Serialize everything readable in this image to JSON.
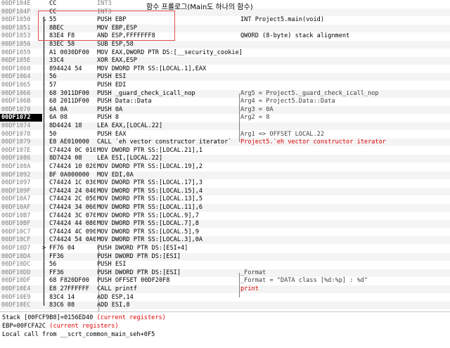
{
  "annotation": "함수 프롤로그(Main도 하나의 함수)",
  "rows": [
    {
      "addr": "00DF104E",
      "mark": "",
      "bytes": "CC",
      "dis": "INT3",
      "cmt": ""
    },
    {
      "addr": "00DF104F",
      "mark": "",
      "bytes": "CC",
      "dis": "INT3",
      "cmt": ""
    },
    {
      "addr": "00DF1050",
      "mark": "$",
      "bytes": "55",
      "dis": "PUSH EBP",
      "cmt": "INT Project5.main(void)"
    },
    {
      "addr": "00DF1051",
      "mark": "·",
      "bytes": "8BEC",
      "dis": "MOV EBP,ESP",
      "cmt": ""
    },
    {
      "addr": "00DF1053",
      "mark": "·",
      "bytes": "83E4 F8",
      "dis": "AND ESP,FFFFFFF8",
      "cmt": "QWORD (8-byte) stack alignment"
    },
    {
      "addr": "00DF1056",
      "mark": "·",
      "bytes": "83EC 58",
      "dis": "SUB ESP,58",
      "cmt": ""
    },
    {
      "addr": "00DF1059",
      "mark": "·",
      "bytes": "A1 0030DF00",
      "dis": "MOV EAX,DWORD PTR DS:[__security_cookie]",
      "cmt": ""
    },
    {
      "addr": "00DF105E",
      "mark": "·",
      "bytes": "33C4",
      "dis": "XOR EAX,ESP",
      "cmt": ""
    },
    {
      "addr": "00DF1060",
      "mark": "·",
      "bytes": "894424 54",
      "dis": "MOV DWORD PTR SS:[LOCAL.1],EAX",
      "cmt": ""
    },
    {
      "addr": "00DF1064",
      "mark": "·",
      "bytes": "56",
      "dis": "PUSH ESI",
      "cmt": ""
    },
    {
      "addr": "00DF1065",
      "mark": "·",
      "bytes": "57",
      "dis": "PUSH EDI",
      "cmt": ""
    },
    {
      "addr": "00DF1066",
      "mark": "·",
      "bytes": "68 3011DF00",
      "dis": "PUSH _guard_check_icall_nop",
      "cmt": "Arg5 = Project5._guard_check_icall_nop"
    },
    {
      "addr": "00DF106B",
      "mark": "·",
      "bytes": "68 2011DF00",
      "dis": "PUSH Data::Data",
      "cmt": "Arg4 = Project5.Data::Data"
    },
    {
      "addr": "00DF1070",
      "mark": "·",
      "bytes": "6A 0A",
      "dis": "PUSH 0A",
      "cmt": "Arg3 = 0A"
    },
    {
      "addr": "00DF1072",
      "mark": "·",
      "bytes": "6A 08",
      "dis": "PUSH 8",
      "cmt": "Arg2 = 8"
    },
    {
      "addr": "00DF1074",
      "mark": "·",
      "bytes": "8D4424 18",
      "dis": "LEA EAX,[LOCAL.22]",
      "cmt": ""
    },
    {
      "addr": "00DF1078",
      "mark": "·",
      "bytes": "50",
      "dis": "PUSH EAX",
      "cmt": "Arg1 => OFFSET LOCAL.22"
    },
    {
      "addr": "00DF1079",
      "mark": "·",
      "bytes": "E8 AE010000",
      "dis": "CALL `eh vector constructor iterator`",
      "cmt": "Project5.`eh vector constructor iterator"
    },
    {
      "addr": "00DF107E",
      "mark": "·",
      "bytes": "C74424 0C 010",
      "dis": "MOV DWORD PTR SS:[LOCAL.21],1",
      "cmt": ""
    },
    {
      "addr": "00DF1086",
      "mark": "·",
      "bytes": "8D7424 08",
      "dis": "LEA ESI,[LOCAL.22]",
      "cmt": ""
    },
    {
      "addr": "00DF108A",
      "mark": "·",
      "bytes": "C74424 10 020",
      "dis": "MOV DWORD PTR SS:[LOCAL.19],2",
      "cmt": ""
    },
    {
      "addr": "00DF1092",
      "mark": "·",
      "bytes": "BF 0A000000",
      "dis": "MOV EDI,0A",
      "cmt": ""
    },
    {
      "addr": "00DF1097",
      "mark": "·",
      "bytes": "C74424 1C 030",
      "dis": "MOV DWORD PTR SS:[LOCAL.17],3",
      "cmt": ""
    },
    {
      "addr": "00DF109F",
      "mark": "·",
      "bytes": "C74424 24 040",
      "dis": "MOV DWORD PTR SS:[LOCAL.15],4",
      "cmt": ""
    },
    {
      "addr": "00DF10A7",
      "mark": "·",
      "bytes": "C74424 2C 050",
      "dis": "MOV DWORD PTR SS:[LOCAL.13],5",
      "cmt": ""
    },
    {
      "addr": "00DF10AF",
      "mark": "·",
      "bytes": "C74424 34 060",
      "dis": "MOV DWORD PTR SS:[LOCAL.11],6",
      "cmt": ""
    },
    {
      "addr": "00DF10B7",
      "mark": "·",
      "bytes": "C74424 3C 070",
      "dis": "MOV DWORD PTR SS:[LOCAL.9],7",
      "cmt": ""
    },
    {
      "addr": "00DF10BF",
      "mark": "·",
      "bytes": "C74424 44 080",
      "dis": "MOV DWORD PTR SS:[LOCAL.7],8",
      "cmt": ""
    },
    {
      "addr": "00DF10C7",
      "mark": "·",
      "bytes": "C74424 4C 090",
      "dis": "MOV DWORD PTR SS:[LOCAL.5],9",
      "cmt": ""
    },
    {
      "addr": "00DF10CF",
      "mark": "·",
      "bytes": "C74424 54 0A0",
      "dis": "MOV DWORD PTR SS:[LOCAL.3],0A",
      "cmt": ""
    },
    {
      "addr": "00DF10D7",
      "mark": ">",
      "bytes": "FF76 04",
      "dis": "PUSH DWORD PTR DS:[ESI+4]",
      "cmt": ""
    },
    {
      "addr": "00DF10DA",
      "mark": "·",
      "bytes": "FF36",
      "dis": "PUSH DWORD PTR DS:[ESI]",
      "cmt": ""
    },
    {
      "addr": "00DF10DC",
      "mark": "·",
      "bytes": "56",
      "dis": "PUSH ESI",
      "cmt": ""
    },
    {
      "addr": "00DF10DD",
      "mark": "·",
      "bytes": "FF36",
      "dis": "PUSH DWORD PTR DS:[ESI]",
      "cmt": "_Format"
    },
    {
      "addr": "00DF10DF",
      "mark": "·",
      "bytes": "68 F820DF00",
      "dis": "PUSH OFFSET 00DF20F8",
      "cmt": "_Format = \"DATA class [%d:%p] : %d\""
    },
    {
      "addr": "00DF10E4",
      "mark": "·",
      "bytes": "E8 27FFFFFF",
      "dis": "CALL printf",
      "cmt": "print"
    },
    {
      "addr": "00DF10E9",
      "mark": "·",
      "bytes": "83C4 14",
      "dis": "ADD ESP,14",
      "cmt": ""
    },
    {
      "addr": "00DF10EC",
      "mark": "·",
      "bytes": "83C6 08",
      "dis": "ADD ESI,8",
      "cmt": ""
    }
  ],
  "current_row_addr": "00DF1072",
  "bottom": {
    "line1_main": "Stack [00FCF9B8]=0156ED40 ",
    "line1_red": "(current registers)",
    "line2_main": "EBP=00FCFA2C ",
    "line2_red": "(current registers)",
    "line3": "Local call from __scrt_common_main_seh+0F5"
  },
  "colors": {
    "red": "#e00000",
    "highlight_box": "#e05050",
    "address": "#808080"
  }
}
